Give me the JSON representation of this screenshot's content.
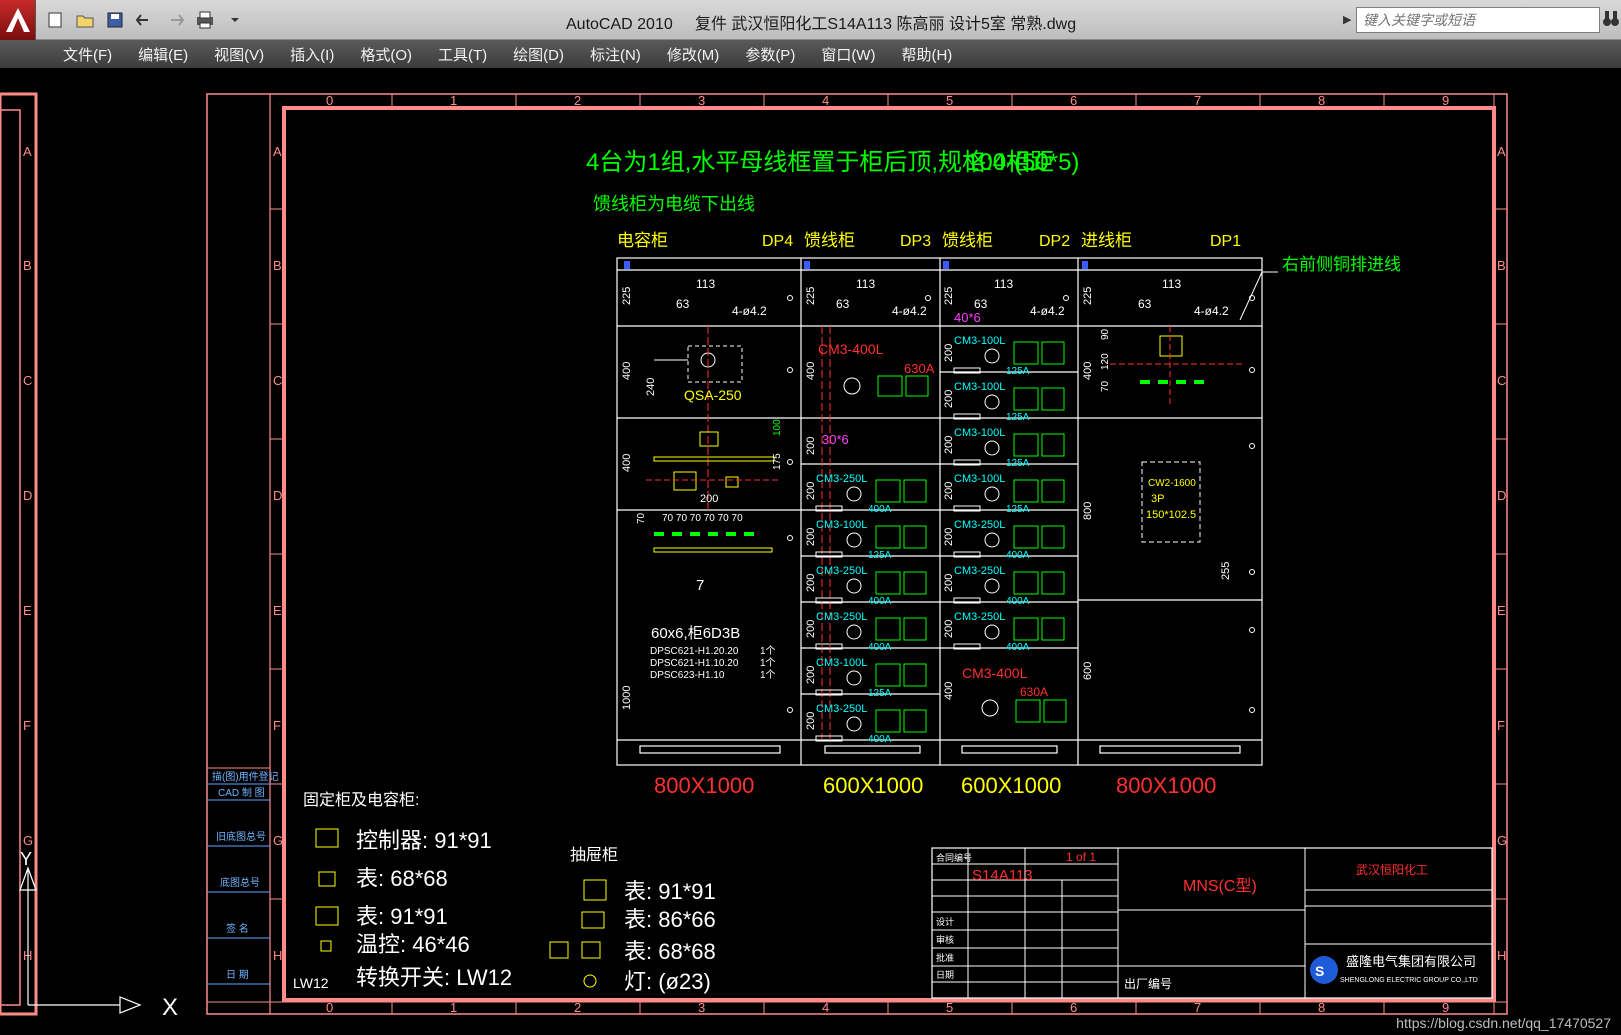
{
  "window": {
    "app_name": "AutoCAD 2010",
    "document_title": "复件 武汉恒阳化工S14A113 陈高丽 设计5室 常熟.dwg",
    "search_placeholder": "键入关键字或短语"
  },
  "menu": [
    "文件(F)",
    "编辑(E)",
    "视图(V)",
    "插入(I)",
    "格式(O)",
    "工具(T)",
    "绘图(D)",
    "标注(N)",
    "修改(M)",
    "参数(P)",
    "窗口(W)",
    "帮助(H)"
  ],
  "ruler": {
    "columns": [
      "0",
      "1",
      "2",
      "3",
      "4",
      "5",
      "6",
      "7",
      "8",
      "9"
    ],
    "rows": [
      "A",
      "B",
      "C",
      "D",
      "E",
      "F",
      "G",
      "H"
    ]
  },
  "drawing": {
    "heading_1": "4台为1组,水平母线框置于柜后顶,规格:4-(50*5)",
    "heading_1_spacing": "100相距",
    "heading_2": "馈线柜为电缆下出线",
    "right_note": "右前侧铜排进线",
    "cabinets": [
      {
        "name": "电容柜",
        "code": "DP4",
        "size": "800X1000"
      },
      {
        "name": "馈线柜",
        "code": "DP3",
        "size": "600X1000"
      },
      {
        "name": "馈线柜",
        "code": "DP2",
        "size": "600X1000"
      },
      {
        "name": "进线柜",
        "code": "DP1",
        "size": "800X1000"
      }
    ],
    "labels": {
      "qsa": "QSA-250",
      "cm3_400l": "CM3-400L",
      "cm3_100l": "CM3-100L",
      "cm3_250l": "CM3-250L",
      "amp_630": "630A",
      "amp_125": "125A",
      "amp_400": "400A",
      "bar_40x6": "40*6",
      "bar_30x6": "30*6",
      "dim_113": "113",
      "dim_63": "63",
      "dim_hole": "4-ø4.2",
      "dim_225": "225",
      "dim_400": "400",
      "dim_200": "200",
      "dim_800": "800",
      "dim_600": "600",
      "dim_1000": "1000",
      "dim_240": "240",
      "dim_90": "90",
      "dim_120": "120",
      "dim_70": "70",
      "dim_100": "100",
      "dim_175": "175",
      "dim_255": "255",
      "dim_spacing": "70 70 70 70 70 70",
      "cw2_1": "CW2-1600",
      "cw2_2": "3P",
      "cw2_3": "150*102.5",
      "caps_count": "7",
      "caps_desc": "60x6,柜6D3B",
      "dpsc_1": "DPSC621-H1.20.20",
      "dpsc_2": "DPSC621-H1.10.20",
      "dpsc_3": "DPSC623-H1.10",
      "qty_1": "1个"
    },
    "legend_fixed_title": "固定柜及电容柜:",
    "legend_fixed": [
      {
        "label": "控制器: 91*91"
      },
      {
        "label": "表: 68*68"
      },
      {
        "label": "表: 91*91"
      },
      {
        "label": "温控: 46*46"
      },
      {
        "label": "转换开关: LW12"
      }
    ],
    "lw12": "LW12",
    "legend_draw_title": "抽屉柜",
    "legend_draw": [
      {
        "label": "表: 91*91"
      },
      {
        "label": "表: 86*66"
      },
      {
        "label": "表: 68*68"
      },
      {
        "label": "灯: (ø23)"
      }
    ],
    "title_block": {
      "project_no": "S14A113",
      "model": "MNS(C型)",
      "client": "武汉恒阳化工",
      "company_cn": "盛隆电气集团有限公司",
      "company_en": "SHENGLONG ELECTRIC GROUP CO.,LTD",
      "factory_no": "出厂编号",
      "sheet": "1 of 1",
      "rows": [
        "合同编号",
        "设计",
        "审核",
        "批准",
        "日期"
      ]
    },
    "left_strip": [
      "描(图)用件登记",
      "CAD 制 图",
      "旧底图总号",
      "底图总号",
      "签 名",
      "日 期"
    ]
  },
  "watermark": "https://blog.csdn.net/qq_17470527"
}
